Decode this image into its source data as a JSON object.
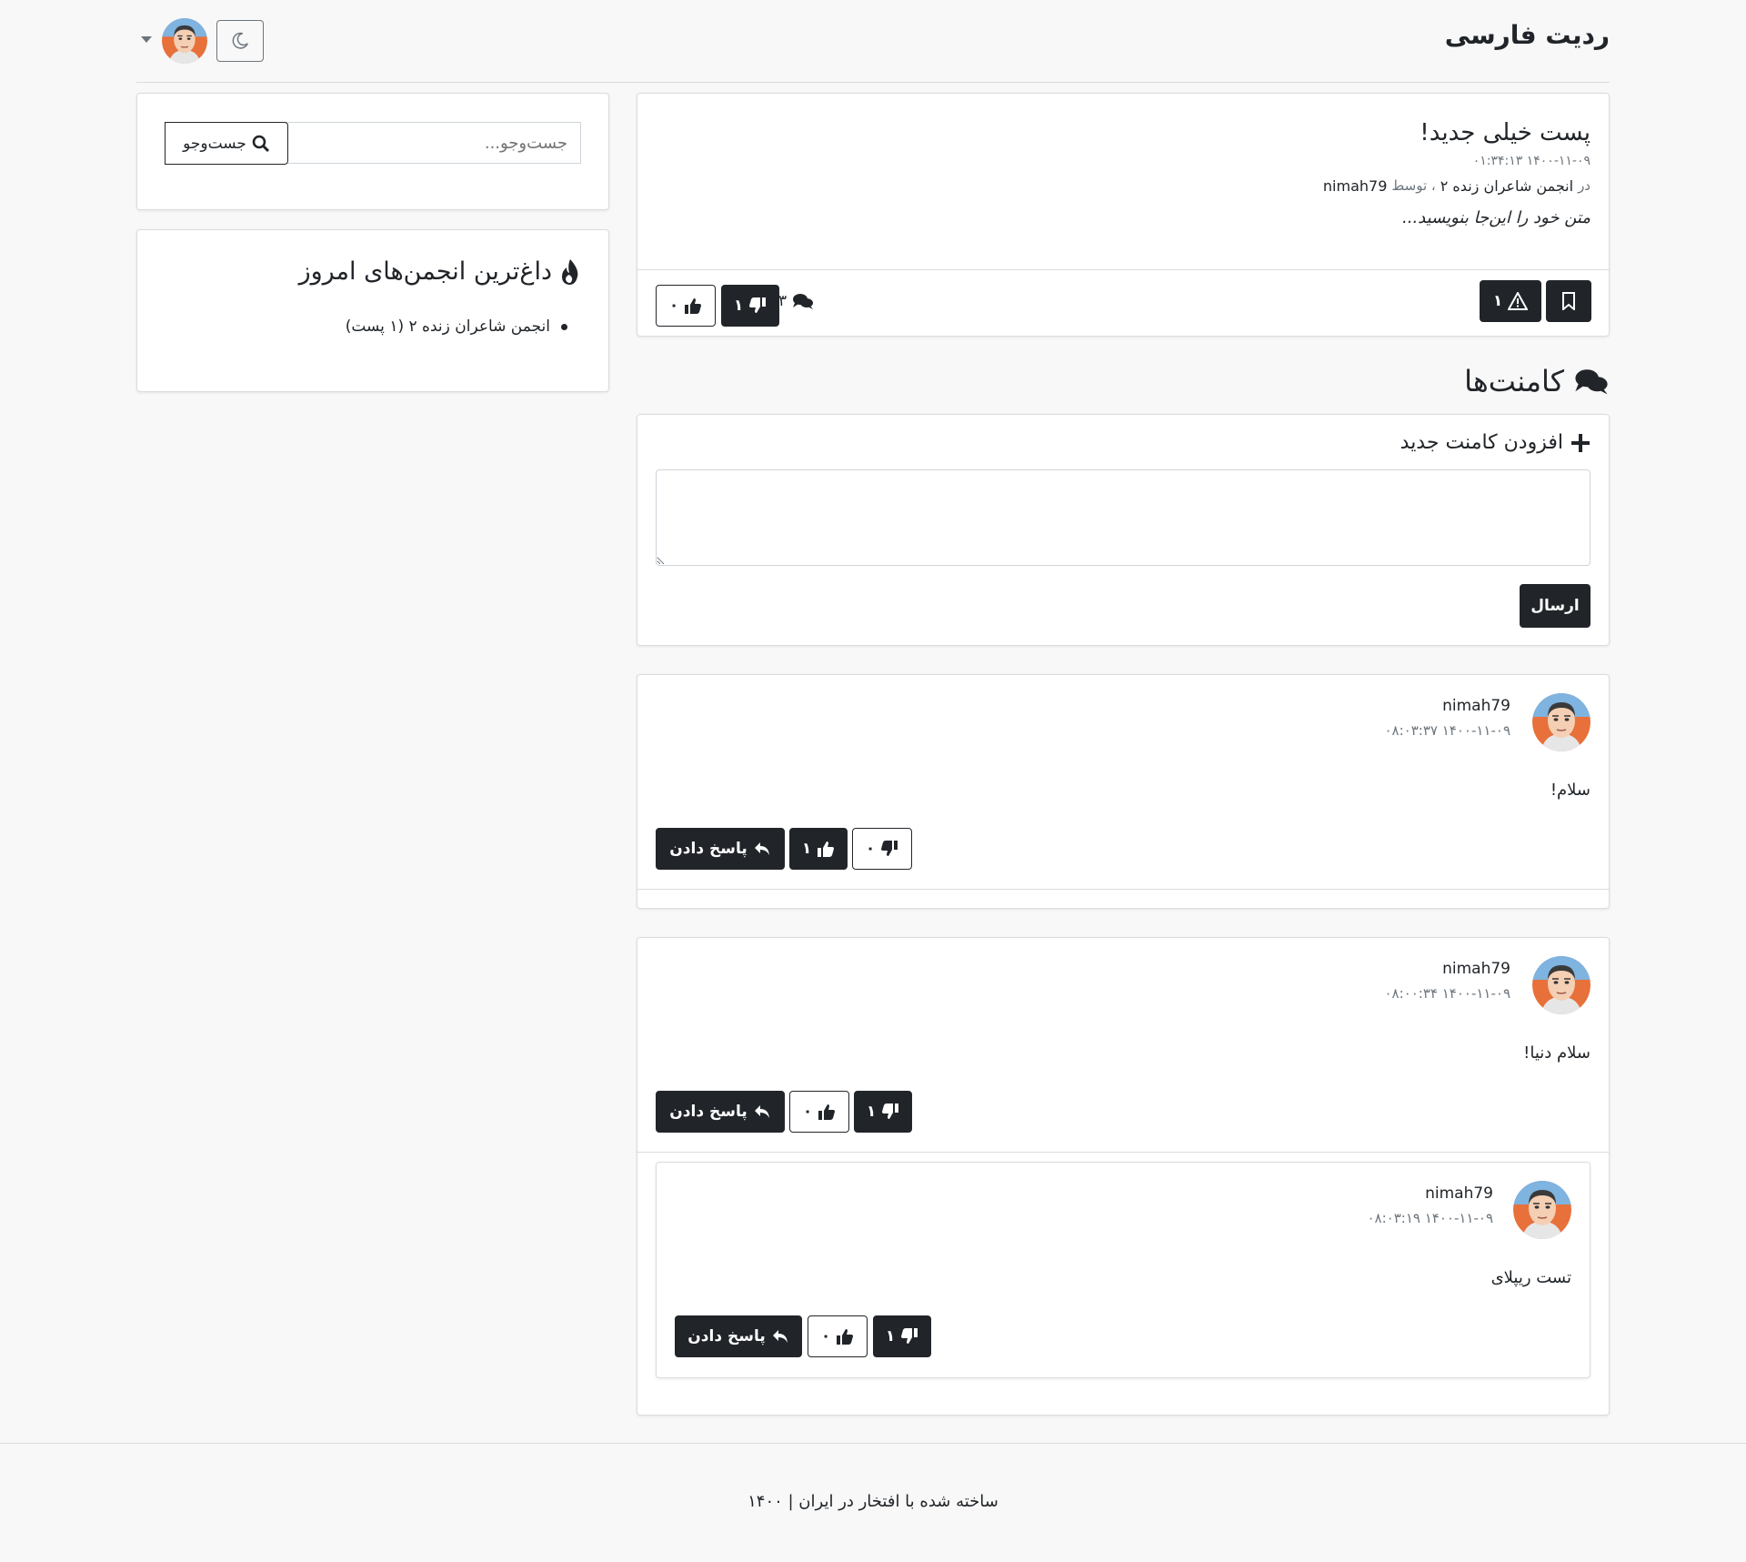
{
  "header": {
    "brand": "ردیت فارسی"
  },
  "post": {
    "title": "پست خیلی جدید!",
    "date": "۱۴۰۰-۱۱-۰۹ ۰۱:۳۴:۱۳",
    "in_label": "در",
    "community": "انجمن شاعران زنده ۲",
    "by_label": "، توسط",
    "author": "nimah79",
    "body": "متن خود را این‌جا بنویسید...",
    "report_count": "۱",
    "comment_count": "۳",
    "dislike_count": "۱",
    "like_count": "۰"
  },
  "comments_section": {
    "heading": "کامنت‌ها",
    "add_heading": "افزودن کامنت جدید",
    "submit_label": "ارسال"
  },
  "comments": [
    {
      "author": "nimah79",
      "date": "۱۴۰۰-۱۱-۰۹ ۰۸:۰۳:۳۷",
      "text": "سلام!",
      "reply_label": "پاسخ دادن",
      "like_count": "۱",
      "dislike_count": "۰"
    },
    {
      "author": "nimah79",
      "date": "۱۴۰۰-۱۱-۰۹ ۰۸:۰۰:۳۴",
      "text": "سلام دنیا!",
      "reply_label": "پاسخ دادن",
      "like_count": "۰",
      "dislike_count": "۱",
      "reply": {
        "author": "nimah79",
        "date": "۱۴۰۰-۱۱-۰۹ ۰۸:۰۳:۱۹",
        "text": "تست ریپلای",
        "reply_label": "پاسخ دادن",
        "like_count": "۰",
        "dislike_count": "۱"
      }
    }
  ],
  "sidebar": {
    "search_placeholder": "جست‌وجو...",
    "search_button": "جست‌وجو",
    "hot_heading": "داغ‌ترین انجمن‌های امروز",
    "hot_items": [
      "انجمن شاعران زنده ۲ (۱ پست)"
    ]
  },
  "footer": {
    "text": "ساخته شده با افتخار در ایران | ۱۴۰۰"
  },
  "icons": {
    "theme": "moon-icon",
    "fire": "fire-icon",
    "comments": "comments-icon",
    "plus": "plus-icon",
    "bookmark": "bookmark-icon",
    "report": "warning-icon",
    "like": "thumbs-up-icon",
    "dislike": "thumbs-down-icon",
    "reply": "reply-icon",
    "search": "search-icon"
  }
}
